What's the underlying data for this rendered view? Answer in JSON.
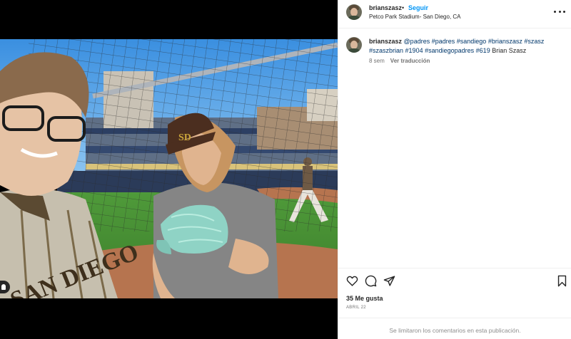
{
  "post": {
    "username": "brianszasz",
    "dot": "•",
    "follow_label": "Seguir",
    "location": "Petco Park Stadium- San Diego, CA"
  },
  "caption": {
    "username": "brianszasz",
    "mention": "@padres",
    "hashtags": [
      "#padres",
      "#sandiego",
      "#brianszasz",
      "#szasz",
      "#szaszbrian",
      "#1904",
      "#sandiegopadres",
      "#619"
    ],
    "tail": "Brian Szasz",
    "age": "8 sem",
    "translate_label": "Ver traducción"
  },
  "actions": {
    "icons": [
      "heart-icon",
      "comment-icon",
      "share-icon",
      "bookmark-icon"
    ]
  },
  "stats": {
    "likes": "35 Me gusta",
    "date": "ABRIL 22"
  },
  "footer": {
    "comments_limited": "Se limitaron los comentarios en esta publicación."
  },
  "colors": {
    "link_blue": "#0095f6",
    "hashtag": "#00376b",
    "secondary_text": "#737373"
  }
}
